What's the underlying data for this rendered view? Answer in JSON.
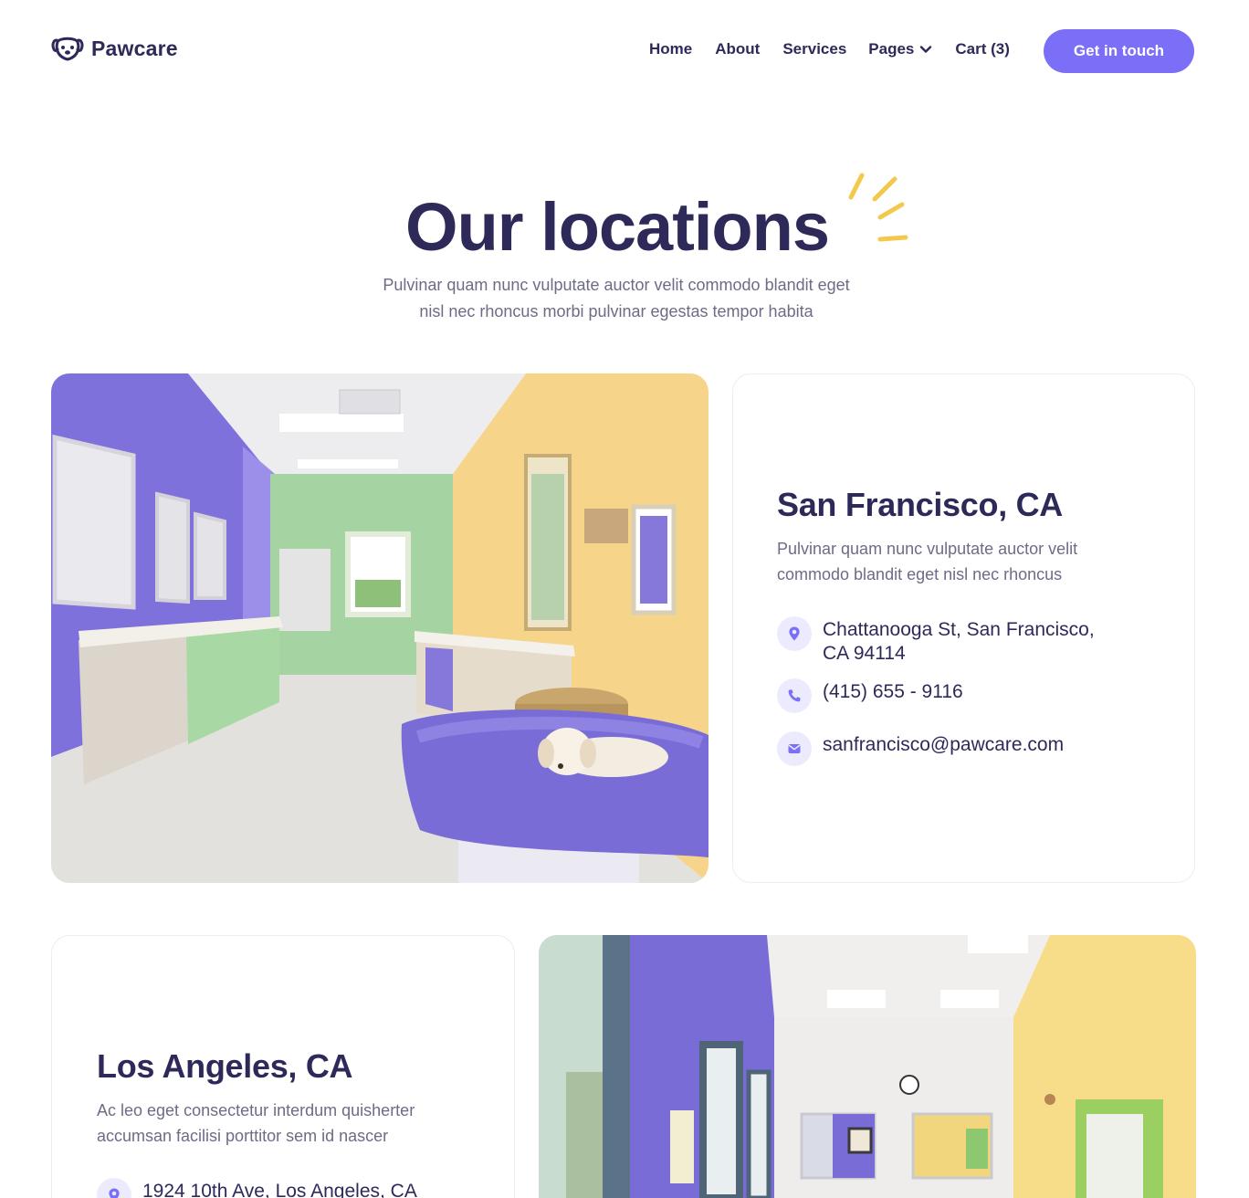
{
  "brand": {
    "name": "Pawcare",
    "accent": "#7a6ff6",
    "dark": "#2d2a5a",
    "sparkle": "#f2c94c"
  },
  "nav": {
    "home": "Home",
    "about": "About",
    "services": "Services",
    "pages": "Pages",
    "cart": "Cart (3)",
    "cta": "Get in touch"
  },
  "hero": {
    "title": "Our locations",
    "subtitle_line1": "Pulvinar quam nunc vulputate auctor velit commodo blandit eget",
    "subtitle_line2": "nisl nec rhoncus morbi pulvinar egestas tempor habita"
  },
  "locations": [
    {
      "city": "San Francisco, CA",
      "desc_line1": "Pulvinar quam nunc vulputate auctor velit",
      "desc_line2": "commodo blandit eget nisl nec rhoncus",
      "address_line1": "Chattanooga St, San Francisco,",
      "address_line2": "CA 94114",
      "phone": "(415) 655 - 9116",
      "email": "sanfrancisco@pawcare.com",
      "icons": [
        "location-pin-icon",
        "phone-icon",
        "mail-icon"
      ]
    },
    {
      "city": "Los Angeles, CA",
      "desc_line1": "Ac leo eget consectetur interdum quisherter",
      "desc_line2": "accumsan facilisi porttitor sem id nascer",
      "address_line1": "1924 10th Ave, Los Angeles, CA",
      "icons": [
        "location-pin-icon"
      ]
    }
  ]
}
